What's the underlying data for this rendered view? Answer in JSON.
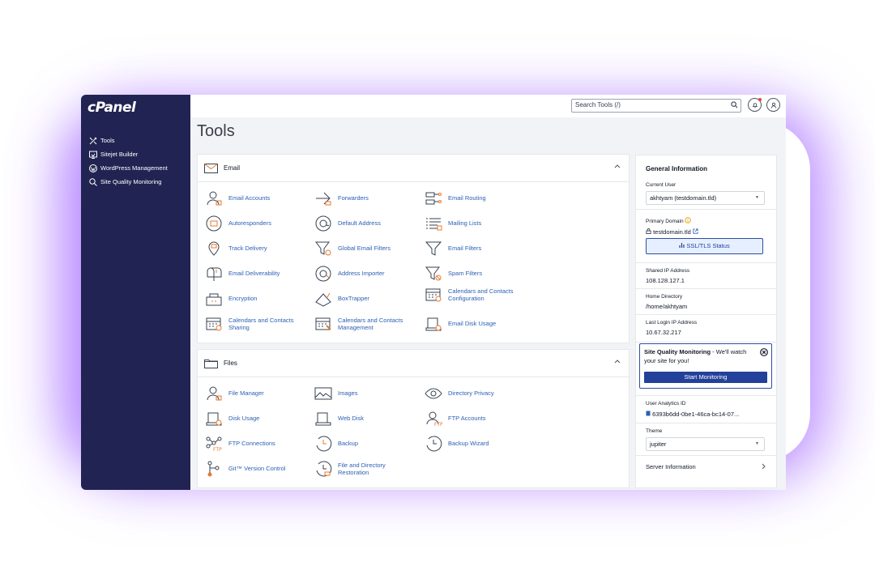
{
  "brand": {
    "logo_text": "cPanel"
  },
  "sidebar": {
    "items": [
      {
        "label": "Tools",
        "icon": "tools-icon"
      },
      {
        "label": "Sitejet Builder",
        "icon": "sitejet-icon"
      },
      {
        "label": "WordPress Management",
        "icon": "wordpress-icon"
      },
      {
        "label": "Site Quality Monitoring",
        "icon": "search-monitor-icon"
      }
    ]
  },
  "topbar": {
    "search_placeholder": "Search Tools (/)"
  },
  "page": {
    "title": "Tools"
  },
  "email_panel": {
    "title": "Email",
    "tools": [
      "Email Accounts",
      "Forwarders",
      "Email Routing",
      "Autoresponders",
      "Default Address",
      "Mailing Lists",
      "Track Delivery",
      "Global Email Filters",
      "Email Filters",
      "Email Deliverability",
      "Address Importer",
      "Spam Filters",
      "Encryption",
      "BoxTrapper",
      "Calendars and Contacts Configuration",
      "Calendars and Contacts Sharing",
      "Calendars and Contacts Management",
      "Email Disk Usage"
    ]
  },
  "files_panel": {
    "title": "Files",
    "tools": [
      "File Manager",
      "Images",
      "Directory Privacy",
      "Disk Usage",
      "Web Disk",
      "FTP Accounts",
      "FTP Connections",
      "Backup",
      "Backup Wizard",
      "Git™ Version Control",
      "File and Directory Restoration"
    ]
  },
  "general_info": {
    "title": "General Information",
    "current_user_label": "Current User",
    "current_user": "akhtyam (testdomain.tld)",
    "primary_domain_label": "Primary Domain",
    "primary_domain": "testdomain.tld",
    "ssl_button": "SSL/TLS Status",
    "shared_ip_label": "Shared IP Address",
    "shared_ip": "108.128.127.1",
    "home_dir_label": "Home Directory",
    "home_dir": "/home/akhtyam",
    "last_login_label": "Last Login IP Address",
    "last_login": "10.67.32.217",
    "sqm_bold": "Site Quality Monitoring",
    "sqm_text": " - We'll watch your site for you!",
    "sqm_button": "Start Monitoring",
    "analytics_label": "User Analytics ID",
    "analytics_id": "6393b6dd-0be1-46ca-bc14-07...",
    "theme_label": "Theme",
    "theme": "jupiter",
    "server_info": "Server Information"
  },
  "colors": {
    "sidebar": "#212452",
    "accent": "#23419a",
    "link": "#2b5fb4",
    "icon_accent": "#e8782e",
    "glow": "#9650ff"
  }
}
